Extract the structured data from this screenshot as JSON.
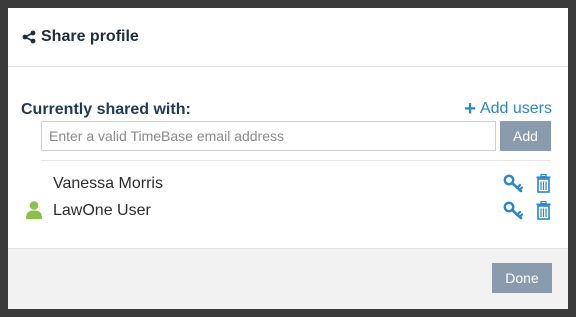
{
  "modal": {
    "title": "Share profile",
    "title_icon": "share-icon"
  },
  "share": {
    "section_title": "Currently shared with:",
    "add_users_label": "Add users",
    "email_placeholder": "Enter a valid TimeBase email address",
    "email_value": "",
    "add_button_label": "Add"
  },
  "users": [
    {
      "name": "Vanessa Morris",
      "has_avatar": false
    },
    {
      "name": "LawOne User",
      "has_avatar": true
    }
  ],
  "footer": {
    "done_label": "Done"
  },
  "colors": {
    "accent_blue": "#2a86c7",
    "button_gray": "#8a9bad",
    "avatar_green": "#8cc04b",
    "backdrop": "#3b3b3b"
  }
}
